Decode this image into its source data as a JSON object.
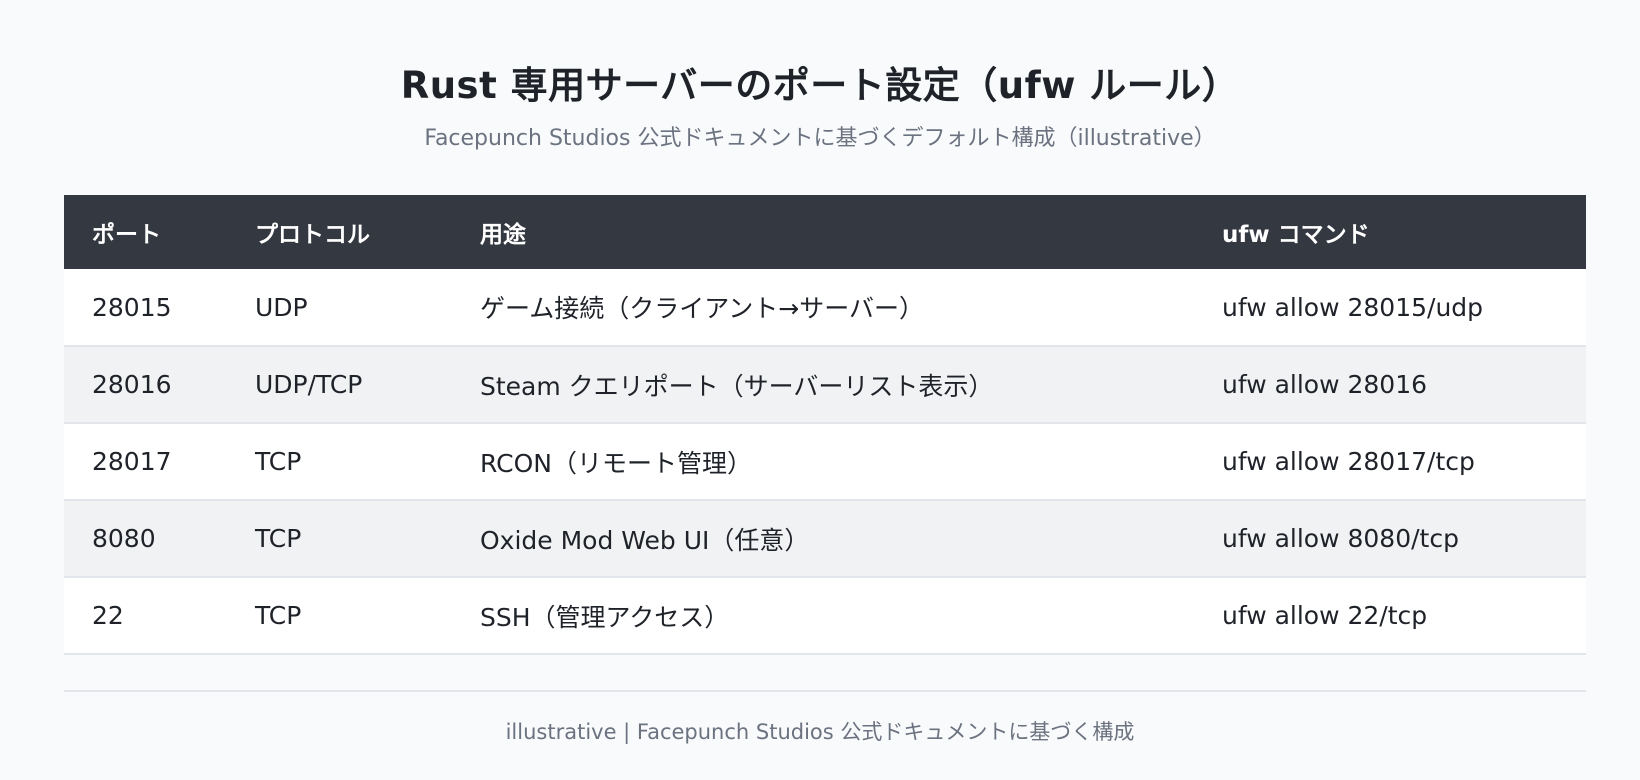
{
  "header": {
    "title": "Rust 専用サーバーのポート設定（ufw ルール）",
    "subtitle": "Facepunch Studios 公式ドキュメントに基づくデフォルト構成（illustrative）"
  },
  "table": {
    "columns": [
      "ポート",
      "プロトコル",
      "用途",
      "ufw コマンド"
    ],
    "rows": [
      {
        "port": "28015",
        "protocol": "UDP",
        "purpose": "ゲーム接続（クライアント→サーバー）",
        "command": "ufw allow 28015/udp"
      },
      {
        "port": "28016",
        "protocol": "UDP/TCP",
        "purpose": "Steam クエリポート（サーバーリスト表示）",
        "command": "ufw allow 28016"
      },
      {
        "port": "28017",
        "protocol": "TCP",
        "purpose": "RCON（リモート管理）",
        "command": "ufw allow 28017/tcp"
      },
      {
        "port": "8080",
        "protocol": "TCP",
        "purpose": "Oxide Mod Web UI（任意）",
        "command": "ufw allow 8080/tcp"
      },
      {
        "port": "22",
        "protocol": "TCP",
        "purpose": "SSH（管理アクセス）",
        "command": "ufw allow 22/tcp"
      }
    ]
  },
  "footer": {
    "text": "illustrative | Facepunch Studios 公式ドキュメントに基づく構成"
  },
  "colors": {
    "header_background": "#343840",
    "header_text": "#ffffff",
    "stripe_row": "#f1f2f4",
    "muted_text": "#6b7280"
  }
}
